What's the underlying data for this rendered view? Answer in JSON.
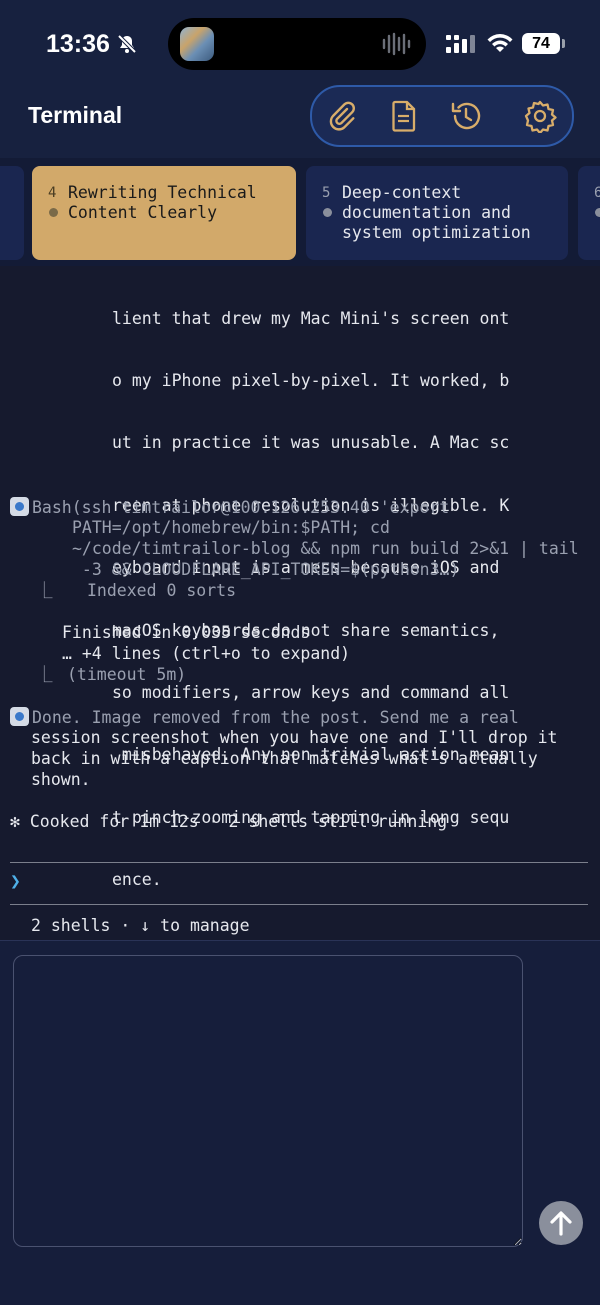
{
  "status_bar": {
    "time": "13:36",
    "battery": "74",
    "icons": [
      "bell-slash-icon",
      "signal-icon",
      "wifi-icon",
      "battery-icon",
      "audio-waveform-icon"
    ]
  },
  "header": {
    "title": "Terminal",
    "toolbar": [
      "paperclip-icon",
      "document-icon",
      "history-icon",
      "gear-icon"
    ]
  },
  "tabs": [
    {
      "number": "4",
      "title": "Rewriting Technical\nContent Clearly",
      "active": true
    },
    {
      "number": "5",
      "title": "Deep-context\ndocumentation and\nsystem optimization",
      "active": false
    },
    {
      "number": "6",
      "title": "",
      "active": false
    }
  ],
  "terminal": {
    "paragraph_lines": [
      "lient that drew my Mac Mini's screen ont",
      "o my iPhone pixel-by-pixel. It worked, b",
      "ut in practice it was unusable. A Mac sc",
      "reen at phone resolution is illegible. K",
      "eyboard input is a mess because iOS and",
      "macOS keyboards do not share semantics,",
      "so modifiers, arrow keys and command all",
      " misbehaved. Any non-trivial action mean",
      "t pinch-zooming and tapping in long sequ",
      "ence."
    ],
    "bash": {
      "tool": "Bash",
      "command_line1": "(ssh timtrailor@100.126.253.40 'export",
      "command_line2": "PATH=/opt/homebrew/bin:$PATH; cd",
      "command_line3": "~/code/timtrailor-blog && npm run build 2>&1 | tail",
      "command_line4": " -3 && CLOUDFLARE_API_TOKEN=$(python3…)",
      "output1": "Indexed 0 sorts",
      "output2": "Finished in 0.035 seconds",
      "output3": "… +4 lines (ctrl+o to expand)",
      "output4": "(timeout 5m)"
    },
    "done_line1": "Done. Image removed from the post. Send me a real",
    "done_line2": "session screenshot when you have one and I'll drop it",
    "done_line3": "back in with a caption that matches what's actually",
    "done_line4": "shown.",
    "status": "✻ Cooked for 1m 12s · 2 shells still running",
    "prompt": "❯",
    "shells": "2 shells · ↓ to manage"
  },
  "input": {
    "value": "",
    "placeholder": ""
  },
  "colors": {
    "background": "#121a35",
    "terminal_bg": "#161a2e",
    "active_tab": "#d2a96a",
    "accent_blue": "#2e5aa8",
    "prompt": "#4fb0e8"
  }
}
